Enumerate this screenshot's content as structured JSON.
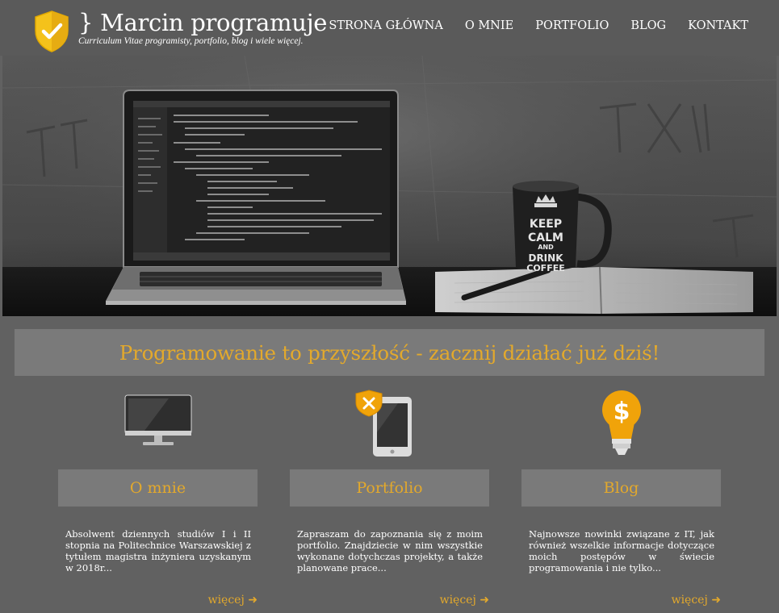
{
  "header": {
    "title": "} Marcin programuje",
    "subtitle": "Curriculum Vitae programisty, portfolio, blog i wiele więcej.",
    "logo_icon": "shield-check-icon",
    "nav": [
      {
        "label": "STRONA GŁÓWNA"
      },
      {
        "label": "O MNIE"
      },
      {
        "label": "PORTFOLIO"
      },
      {
        "label": "BLOG"
      },
      {
        "label": "KONTAKT"
      }
    ]
  },
  "hero": {
    "image": "laptop-and-mug-photo",
    "mug_text": [
      "KEEP",
      "CALM",
      "AND",
      "DRINK",
      "COFFEE"
    ]
  },
  "banner": {
    "text": "Programowanie to przyszłość - zacznij działać już dziś!"
  },
  "columns": [
    {
      "icon": "monitor-icon",
      "title": "O mnie",
      "text": "Absolwent dziennych studiów I i II stopnia na Politechnice Warszawskiej z tytułem magistra inżyniera uzyskanym w 2018r...",
      "more": "więcej ➜"
    },
    {
      "icon": "tablet-shield-icon",
      "title": "Portfolio",
      "text": "Zapraszam do zapoznania się z moim portfolio. Znajdziecie w nim wszystkie wykonane dotychczas projekty, a także planowane prace...",
      "more": "więcej ➜"
    },
    {
      "icon": "lightbulb-dollar-icon",
      "title": "Blog",
      "text": "Najnowsze nowinki związane z IT, jak również wszelkie informacje dotyczące moich postępów w świecie programowania i nie tylko...",
      "more": "więcej ➜"
    }
  ],
  "colors": {
    "accent": "#e3a92c",
    "background": "#616161",
    "panel": "#7a7a7a"
  }
}
